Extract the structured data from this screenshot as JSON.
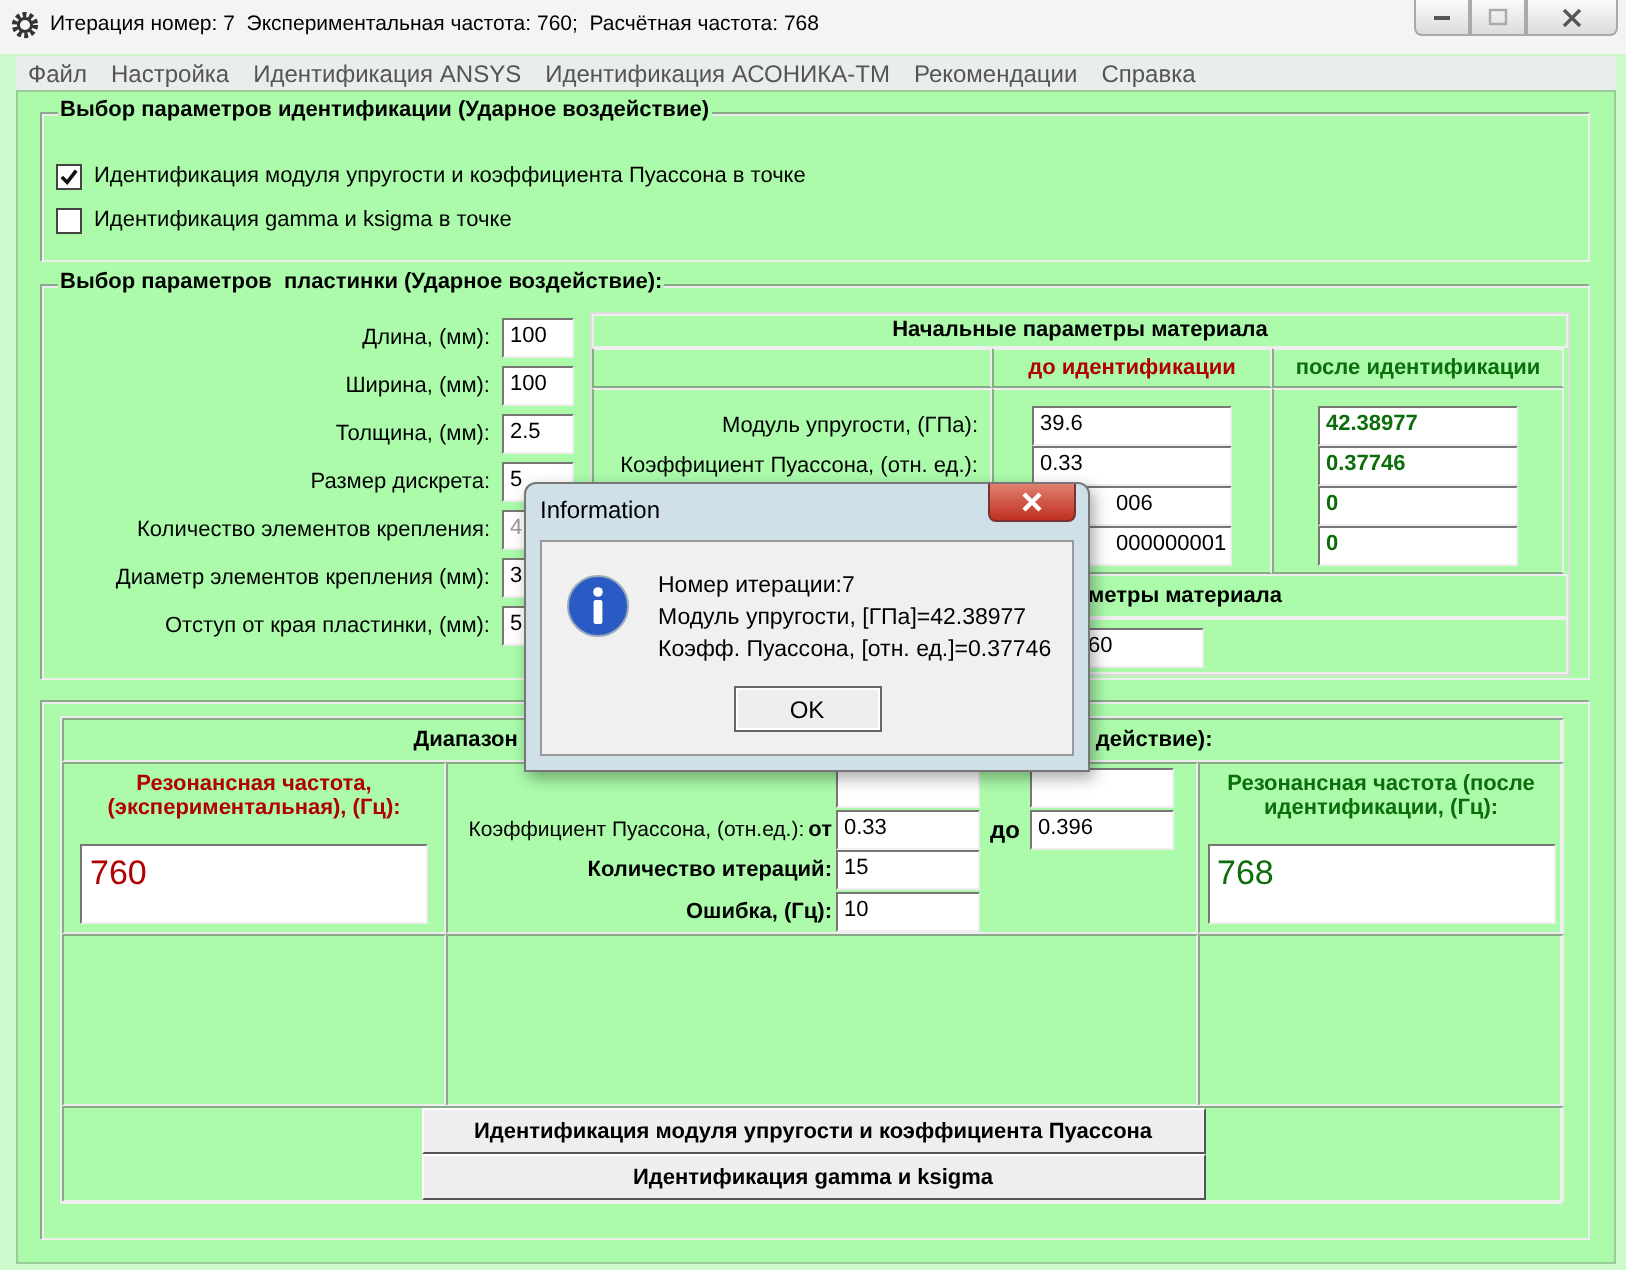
{
  "window": {
    "title": "Итерация номер: 7  Экспериментальная частота: 760;  Расчётная частота: 768"
  },
  "menu": [
    {
      "label": "Файл"
    },
    {
      "label": "Настройка"
    },
    {
      "label": "Идентификация ANSYS"
    },
    {
      "label": "Идентификация АСОНИКА-ТМ"
    },
    {
      "label": "Рекомендации"
    },
    {
      "label": "Справка"
    }
  ],
  "identification_group": {
    "title": "Выбор параметров идентификации (Ударное воздействие)",
    "options": [
      {
        "label": "Идентификация модуля упругости и коэффициента Пуассона в точке",
        "checked": true
      },
      {
        "label": "Идентификация gamma и ksigma в точке",
        "checked": false
      }
    ]
  },
  "plate_group": {
    "title": "Выбор параметров  пластинки (Ударное воздействие):",
    "fields": [
      {
        "label": "Длина, (мм):",
        "value": "100",
        "disabled": false
      },
      {
        "label": "Ширина, (мм):",
        "value": "100",
        "disabled": false
      },
      {
        "label": "Толщина, (мм):",
        "value": "2.5",
        "disabled": false
      },
      {
        "label": "Размер дискрета:",
        "value": "5",
        "disabled": false
      },
      {
        "label": "Количество элементов крепления:",
        "value": "4",
        "disabled": true
      },
      {
        "label": "Диаметр элементов крепления (мм):",
        "value": "3",
        "disabled": false
      },
      {
        "label": "Отступ от края пластинки, (мм):",
        "value": "5",
        "disabled": false
      }
    ]
  },
  "material_table": {
    "title": "Начальные параметры материала",
    "before_heading": "до идентификации",
    "after_heading": "после идентификации",
    "rows": [
      {
        "label": "Модуль упругости, (ГПа):",
        "before": "39.6",
        "after": "42.38977",
        "covered": false
      },
      {
        "label": "Коэффициент Пуассона, (отн. ед.):",
        "before": "0.33",
        "after": "0.37746",
        "covered": false
      },
      {
        "before": "006",
        "after": "0",
        "covered": true
      },
      {
        "before": "000000001",
        "after": "0",
        "covered": true
      }
    ]
  },
  "material_table_2": {
    "title": "метры материала",
    "value": "60"
  },
  "range_group": {
    "title_left": "Диапазон",
    "title_right": "действие):",
    "experimental": {
      "label": "Резонансная частота, (экспериментальная), (Гц):",
      "value": "760"
    },
    "calculated": {
      "label": "Резонансная частота (после идентификации, (Гц):",
      "value": "768"
    },
    "poisson": {
      "label": "Коэффициент Пуассона, (отн.ед.):",
      "from_label": "от",
      "from": "0.33",
      "to_label": "до",
      "to": "0.396"
    },
    "params": [
      {
        "label": "Количество итераций:",
        "value": "15"
      },
      {
        "label": "Ошибка, (Гц):",
        "value": "10"
      }
    ],
    "buttons": [
      {
        "label": "Идентификация модуля упругости и коэффициента Пуассона"
      },
      {
        "label": "Идентификация gamma и ksigma"
      }
    ]
  },
  "dialog": {
    "title": "Information",
    "lines": [
      "Номер итерации:7",
      "Модуль упругости, [ГПа]=42.38977",
      "Коэфф. Пуассона, [отн. ед.]=0.37746"
    ],
    "button": "OK"
  }
}
